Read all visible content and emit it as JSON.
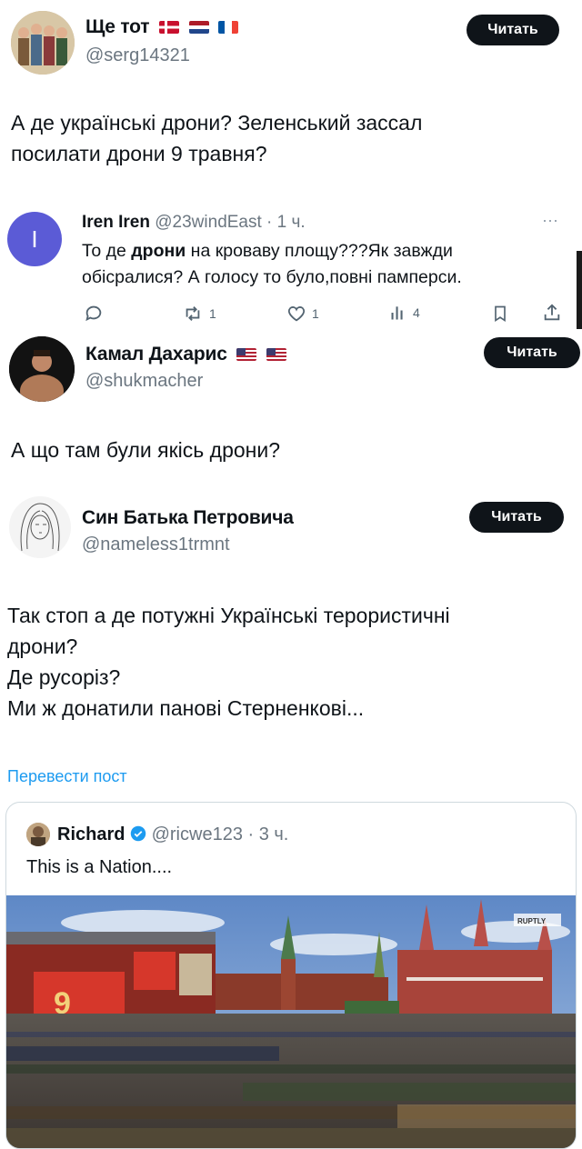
{
  "post1": {
    "author": "Ще тот",
    "handle": "@serg14321",
    "follow": "Читать",
    "text_line1": "А де українські дрони? Зеленський зассал",
    "text_line2": "посилати дрони 9 травня?"
  },
  "reply": {
    "avatar_letter": "I",
    "author": "Iren Iren",
    "meta": "@23windEast · 1 ч.",
    "line1_pre": "То де ",
    "line1_bold": "дрони",
    "line1_post": " на кроваву площу???Як завжди",
    "line2": "обісралися? А голосу то було,повні памперси.",
    "more": "···",
    "retweets": "1",
    "likes": "1",
    "views": "4"
  },
  "post2": {
    "author": "Камал Дахарис",
    "handle": "@shukmacher",
    "follow": "Читать",
    "text": "А що там були якісь дрони?"
  },
  "post3": {
    "author": "Син Батька Петровича",
    "handle": "@nameless1trmnt",
    "follow": "Читать",
    "line1": "Так стоп а де потужні Українські терористичні",
    "line2": "дрони?",
    "line3": "Де русоріз?",
    "line4": "Ми ж донатили панові Стерненкові...",
    "translate": "Перевести пост"
  },
  "quote": {
    "author": "Richard",
    "meta": "@ricwe123 · 3 ч.",
    "text": "This is a Nation....",
    "watermark": "RUPTLY",
    "banner": "9"
  },
  "colors": {
    "link": "#1d9bf0",
    "reply_avatar": "#5b5bd6",
    "muted": "#6b7680"
  }
}
